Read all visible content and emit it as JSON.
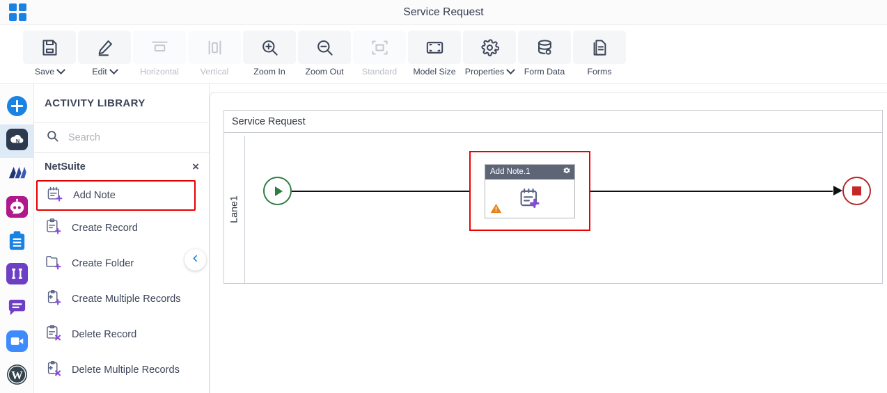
{
  "header": {
    "logo_icon": "grid-apps-icon",
    "title": "Service Request"
  },
  "toolbar": {
    "items": [
      {
        "label": "Save",
        "icon": "save-floppy-icon",
        "has_caret": true,
        "disabled": false
      },
      {
        "label": "Edit",
        "icon": "pencil-edit-icon",
        "has_caret": true,
        "disabled": false
      },
      {
        "label": "Horizontal",
        "icon": "horizontal-layout-icon",
        "has_caret": false,
        "disabled": true
      },
      {
        "label": "Vertical",
        "icon": "vertical-layout-icon",
        "has_caret": false,
        "disabled": true
      },
      {
        "label": "Zoom In",
        "icon": "zoom-in-icon",
        "has_caret": false,
        "disabled": false
      },
      {
        "label": "Zoom Out",
        "icon": "zoom-out-icon",
        "has_caret": false,
        "disabled": false
      },
      {
        "label": "Standard",
        "icon": "standard-size-icon",
        "has_caret": false,
        "disabled": true
      },
      {
        "label": "Model Size",
        "icon": "model-size-icon",
        "has_caret": false,
        "disabled": false
      },
      {
        "label": "Properties",
        "icon": "gear-properties-icon",
        "has_caret": true,
        "disabled": false
      },
      {
        "label": "Form Data",
        "icon": "database-form-data-icon",
        "has_caret": false,
        "disabled": false
      },
      {
        "label": "Forms",
        "icon": "forms-document-icon",
        "has_caret": false,
        "disabled": false
      }
    ]
  },
  "rail": {
    "items": [
      {
        "name": "add-connector",
        "icon": "plus-circle-icon",
        "color": "#1a82e2",
        "active": false
      },
      {
        "name": "netsuite",
        "icon": "netsuite-cloud-icon",
        "color": "#2b3a4f",
        "active": true
      },
      {
        "name": "dynamics",
        "icon": "dynamics-icon",
        "color": "#23356b",
        "active": false
      },
      {
        "name": "chatbot",
        "icon": "robot-chat-icon",
        "color": "#b0188c",
        "active": false
      },
      {
        "name": "clipboard",
        "icon": "clipboard-icon",
        "color": "#1a82e2",
        "active": false
      },
      {
        "name": "integration",
        "icon": "two-bars-icon",
        "color": "#6c3fc5",
        "active": false
      },
      {
        "name": "messaging",
        "icon": "message-bubble-icon",
        "color": "#6c3fc5",
        "active": false
      },
      {
        "name": "zoom-app",
        "icon": "zoom-video-icon",
        "color": "#3d8bfd",
        "active": false
      },
      {
        "name": "wordpress",
        "icon": "wordpress-icon",
        "color": "#34444c",
        "active": false
      }
    ]
  },
  "panel": {
    "title": "ACTIVITY LIBRARY",
    "search": {
      "value": "",
      "placeholder": "Search",
      "icon": "search-icon"
    },
    "group": {
      "name": "NetSuite",
      "close_label": "×"
    },
    "activities": [
      {
        "label": "Add Note",
        "icon": "note-plus-icon",
        "highlighted": true
      },
      {
        "label": "Create Record",
        "icon": "record-plus-icon",
        "highlighted": false
      },
      {
        "label": "Create Folder",
        "icon": "folder-plus-icon",
        "highlighted": false
      },
      {
        "label": "Create Multiple Records",
        "icon": "multi-record-plus-icon",
        "highlighted": false
      },
      {
        "label": "Delete Record",
        "icon": "record-delete-icon",
        "highlighted": false
      },
      {
        "label": "Delete Multiple Records",
        "icon": "multi-record-delete-icon",
        "highlighted": false
      }
    ],
    "collapse_icon": "chevron-left-icon"
  },
  "canvas": {
    "pool_title": "Service Request",
    "lane_title": "Lane1",
    "start_event": {
      "name": "start-event",
      "color": "#2e7d42"
    },
    "end_event": {
      "name": "end-event",
      "color": "#b42828"
    },
    "task": {
      "name": "Add Note.1",
      "gear_icon": "gear-icon",
      "body_icon": "note-plus-icon",
      "warning_icon": "warning-triangle-icon",
      "header_color": "#5d6577",
      "selection_color": "#ee0000"
    }
  }
}
